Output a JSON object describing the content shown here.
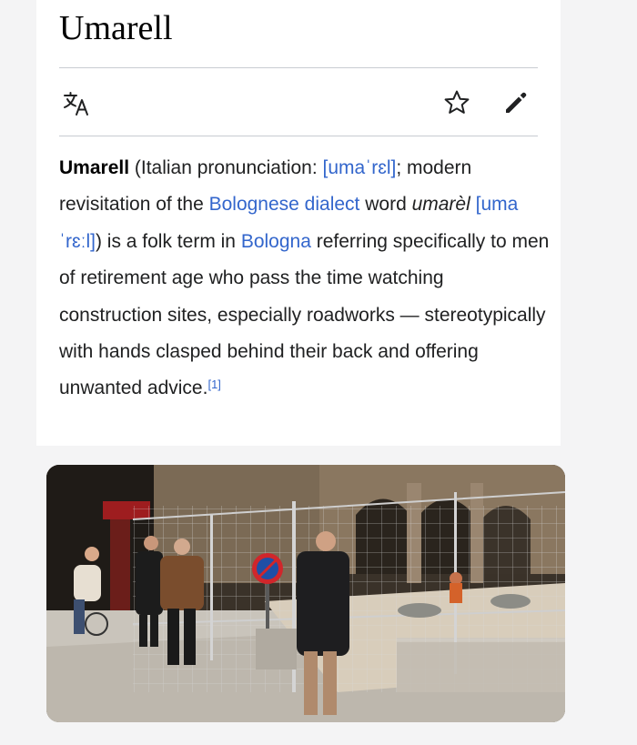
{
  "article": {
    "title": "Umarell",
    "lead": {
      "term": "Umarell",
      "t1": " (Italian pronunciation: ",
      "ipa1": "[umaˈrɛl]",
      "t2": "; modern revisitation of the ",
      "link_dialect": "Bolognese dialect",
      "t3": " word ",
      "word": "umarèl",
      "t4": " ",
      "ipa2": "[umaˈrɛːl]",
      "t5": ") is a folk term in ",
      "link_bologna": "Bologna",
      "t6": " referring specifically to men of retirement age who pass the time watching construction sites, especially roadworks — stereotypically with hands clasped behind their back and offering unwanted advice.",
      "citation": "[1]"
    }
  },
  "toolbar": {
    "language_icon": "translate-icon",
    "watch_icon": "star-icon",
    "edit_icon": "pencil-icon"
  },
  "photo": {
    "sign_colors": {
      "red": "#d0262b",
      "blue": "#1f4fa6"
    }
  },
  "colors": {
    "link": "#3366cc",
    "text": "#202122",
    "divider": "#c8ccd1"
  }
}
